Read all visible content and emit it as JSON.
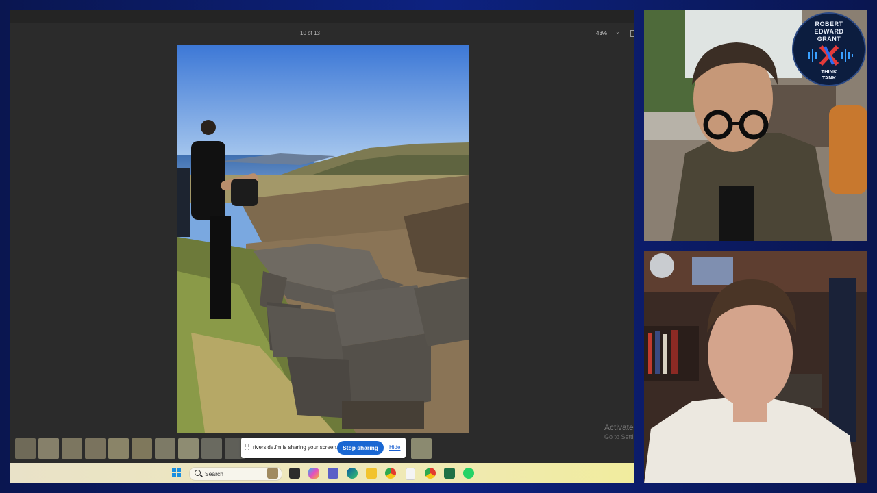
{
  "viewer": {
    "counter": "10 of 13",
    "zoom": "43%",
    "watermark_title": "Activate",
    "watermark_sub": "Go to Setti"
  },
  "share_notice": {
    "text": "riverside.fm is sharing your screen.",
    "stop_label": "Stop sharing",
    "hide_label": "Hide"
  },
  "taskbar": {
    "search_placeholder": "Search",
    "apps": [
      "start-icon",
      "search-icon",
      "widget-icon",
      "task-view-icon",
      "copilot-icon",
      "teams-icon",
      "edge-icon",
      "file-explorer-icon",
      "chrome-icon",
      "notepad-icon",
      "chrome-profile-icon",
      "excel-icon",
      "whatsapp-icon"
    ]
  },
  "podcast_logo": {
    "line1": "ROBERT",
    "line2": "EDWARD",
    "line3": "GRANT",
    "tagline1": "THINK",
    "tagline2": "TANK"
  },
  "colors": {
    "frame": "#0b1a5a",
    "stop_button": "#1967d2",
    "viewer_bg": "#2b2b2b"
  }
}
